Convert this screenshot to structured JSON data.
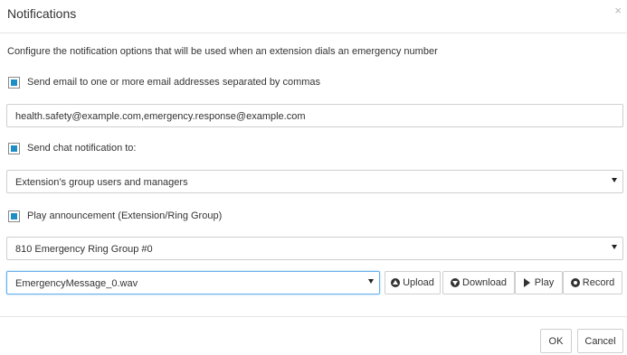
{
  "dialog": {
    "title": "Notifications",
    "close_glyph": "×"
  },
  "description": "Configure the notification options that will be used when an extension dials an emergency number",
  "email": {
    "checkbox_label": "Send email to one or more email addresses separated by commas",
    "checked": true,
    "value": "health.safety@example.com,emergency.response@example.com"
  },
  "chat": {
    "checkbox_label": "Send chat notification to:",
    "checked": true,
    "selected": "Extension’s group users and managers"
  },
  "announcement": {
    "checkbox_label": "Play announcement (Extension/Ring Group)",
    "checked": true,
    "ring_group_selected": "810 Emergency Ring Group #0",
    "file_selected": "EmergencyMessage_0.wav",
    "upload_label": "Upload",
    "download_label": "Download",
    "play_label": "Play",
    "record_label": "Record"
  },
  "footer": {
    "ok_label": "OK",
    "cancel_label": "Cancel"
  },
  "colors": {
    "checkbox_fill": "#1e8fc6",
    "focus_border": "#66afe9"
  }
}
